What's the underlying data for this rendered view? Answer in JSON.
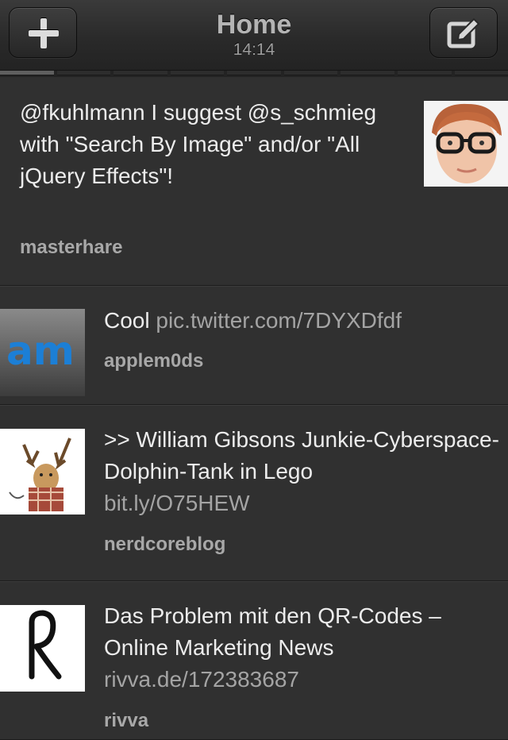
{
  "header": {
    "title": "Home",
    "time": "14:14",
    "add_icon": "plus-icon",
    "compose_icon": "compose-icon"
  },
  "pager": {
    "pages": 9,
    "active": 1
  },
  "tweets": [
    {
      "text": "@fkuhlmann I suggest @s_schmieg with \"Search By Image\" and/or \"All jQuery Effects\"!",
      "link": "",
      "user": "masterhare"
    },
    {
      "text": "Cool ",
      "link": "pic.twitter.com/7DYXDfdf",
      "user": "applem0ds",
      "avatar_text": "am"
    },
    {
      "text": ">> William Gibsons Junkie-Cyberspace-Dolphin-Tank in Lego",
      "link": "bit.ly/O75HEW",
      "user": "nerdcoreblog"
    },
    {
      "text": "Das Problem mit den QR-Codes – Online Marketing News",
      "link": "rivva.de/172383687",
      "user": "rivva"
    }
  ],
  "colors": {
    "background": "#303030",
    "text": "#ececec",
    "link": "#a4a4a4",
    "username": "#a8a8a8"
  }
}
